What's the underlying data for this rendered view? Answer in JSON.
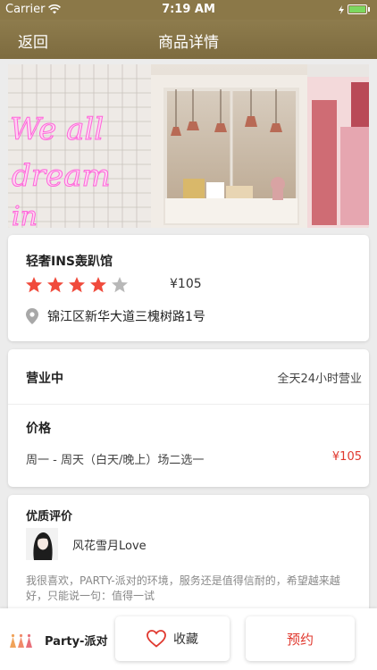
{
  "status_bar": {
    "carrier": "Carrier",
    "time": "7:19 AM"
  },
  "nav": {
    "back_label": "返回",
    "title": "商品详情"
  },
  "hero": {
    "neon_line1": "We all",
    "neon_line2": "dream",
    "neon_line3": "in"
  },
  "shop": {
    "name": "轻奢INS轰趴馆",
    "rating": 4,
    "rating_max": 5,
    "price": "¥105",
    "address": "锦江区新华大道三槐树路1号"
  },
  "business": {
    "status": "营业中",
    "hours": "全天24小时营业",
    "price_title": "价格",
    "package": "周一 - 周天（白天/晚上）场二选一",
    "package_price": "¥105"
  },
  "review": {
    "title": "优质评价",
    "reviewer": "风花雪月Love",
    "text": "我很喜欢，PARTY-派对的环境，服务还是值得信耐的，希望越来越好，只能说一句：值得一试"
  },
  "bottom": {
    "brand": "Party-派对",
    "favorite_label": "收藏",
    "book_label": "预约"
  },
  "colors": {
    "nav_bg": "#8b7848",
    "star_active": "#f04b3c",
    "star_inactive": "#b8b8b8",
    "price_accent": "#e0382e"
  },
  "icons": {
    "wifi": "wifi-icon",
    "location": "location-pin-icon",
    "favorite": "heart-outline-icon",
    "brand": "party-logo-icon"
  }
}
